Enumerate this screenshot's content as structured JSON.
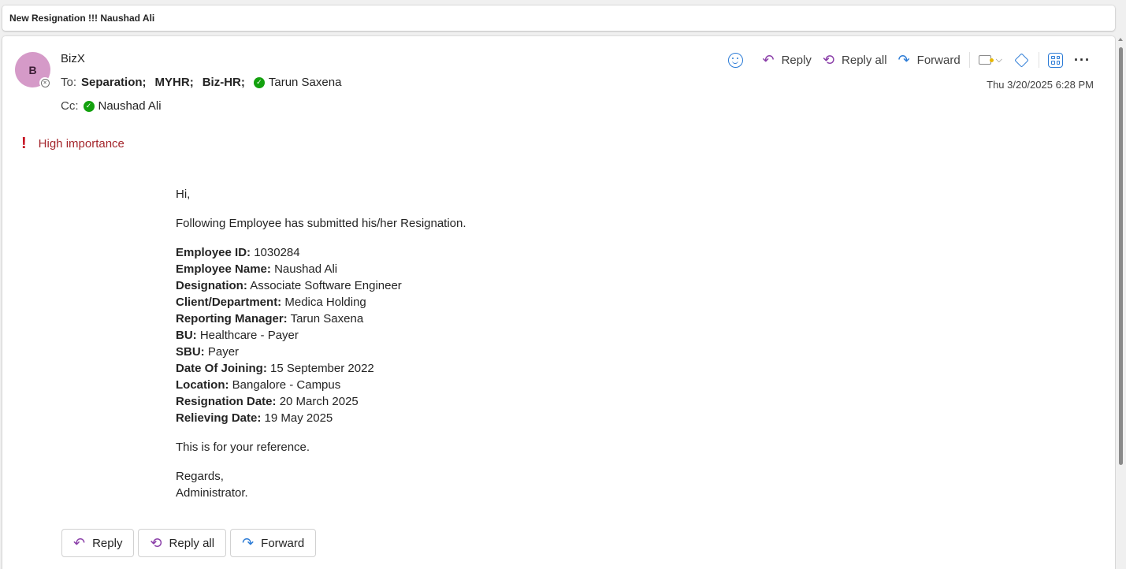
{
  "subject": "New Resignation !!! Naushad Ali",
  "sender": {
    "initial": "B",
    "name": "BizX",
    "avatar_color": "#d59ac8"
  },
  "to": {
    "label": "To:",
    "recipients_bold": [
      "Separation;",
      "MYHR;",
      "Biz-HR;"
    ],
    "verified_recipient": "Tarun Saxena"
  },
  "cc": {
    "label": "Cc:",
    "verified_recipient": "Naushad Ali"
  },
  "toolbar": {
    "reply": "Reply",
    "reply_all": "Reply all",
    "forward": "Forward"
  },
  "timestamp": "Thu 3/20/2025 6:28 PM",
  "importance": "High importance",
  "body": {
    "greeting": "Hi,",
    "intro": "Following Employee has submitted his/her Resignation.",
    "fields": [
      {
        "label": "Employee ID:",
        "value": "1030284"
      },
      {
        "label": "Employee Name:",
        "value": "Naushad Ali"
      },
      {
        "label": "Designation:",
        "value": "Associate Software Engineer"
      },
      {
        "label": "Client/Department:",
        "value": "Medica Holding"
      },
      {
        "label": "Reporting Manager:",
        "value": "Tarun Saxena"
      },
      {
        "label": "BU:",
        "value": "Healthcare - Payer"
      },
      {
        "label": "SBU:",
        "value": "Payer"
      },
      {
        "label": "Date Of Joining:",
        "value": "15 September 2022"
      },
      {
        "label": "Location:",
        "value": "Bangalore - Campus"
      },
      {
        "label": "Resignation Date:",
        "value": "20 March 2025"
      },
      {
        "label": "Relieving Date:",
        "value": "19 May 2025"
      }
    ],
    "reference": "This is for your reference.",
    "regards": "Regards,",
    "signature": "Administrator."
  },
  "bottom_actions": {
    "reply": "Reply",
    "reply_all": "Reply all",
    "forward": "Forward"
  },
  "colors": {
    "importance": "#a4262c",
    "accent_blue": "#2b7bd6",
    "reply_purple": "#8a3ea8",
    "presence_green": "#13a10e"
  }
}
